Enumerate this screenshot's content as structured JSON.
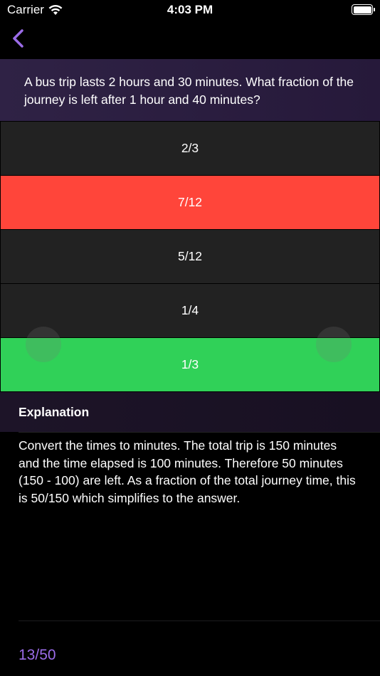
{
  "status_bar": {
    "carrier": "Carrier",
    "time": "4:03 PM"
  },
  "nav": {
    "back_icon": "chevron-left-icon",
    "accent_color": "#9b6ce8"
  },
  "question": {
    "text": "A bus trip lasts 2 hours and 30 minutes. What fraction of the journey is left after 1 hour and 40 minutes?"
  },
  "answers": [
    {
      "label": "2/3",
      "state": "default"
    },
    {
      "label": "7/12",
      "state": "wrong"
    },
    {
      "label": "5/12",
      "state": "default"
    },
    {
      "label": "1/4",
      "state": "default"
    },
    {
      "label": "1/3",
      "state": "correct"
    }
  ],
  "colors": {
    "wrong": "#ff453a",
    "correct": "#30d158",
    "default": "#222222"
  },
  "explanation": {
    "title": "Explanation",
    "body": "Convert the times to minutes. The total trip is 150 minutes and the time elapsed is 100 minutes. Therefore 50 minutes (150 - 100) are left. As a fraction of the total journey time, this is 50/150 which simplifies to the answer."
  },
  "footer": {
    "counter": "13/50"
  }
}
